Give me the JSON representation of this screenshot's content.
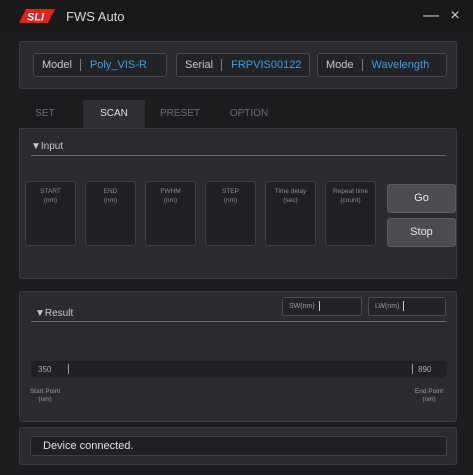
{
  "window": {
    "title": "FWS Auto",
    "logo_text": "SLI",
    "minimize_glyph": "—",
    "close_glyph": "×"
  },
  "device": {
    "model_label": "Model",
    "model_value": "Poly_VIS-R",
    "serial_label": "Serial",
    "serial_value": "FRPVIS00122",
    "mode_label": "Mode",
    "mode_value": "Wavelength"
  },
  "tabs": [
    {
      "label": "SET",
      "active": false
    },
    {
      "label": "SCAN",
      "active": true
    },
    {
      "label": "PRESET",
      "active": false
    },
    {
      "label": "OPTION",
      "active": false
    }
  ],
  "input": {
    "title": "▼Input",
    "params": [
      {
        "name": "START",
        "unit": "(nm)"
      },
      {
        "name": "END",
        "unit": "(nm)"
      },
      {
        "name": "FWHM",
        "unit": "(nm)"
      },
      {
        "name": "STEP",
        "unit": "(nm)"
      },
      {
        "name": "Time delay",
        "unit": "(sec)"
      },
      {
        "name": "Repeat time",
        "unit": "(count)"
      }
    ],
    "go_label": "Go",
    "stop_label": "Stop"
  },
  "result": {
    "title": "▼Result",
    "sw_label": "SW(nm)",
    "lw_label": "LW(nm)",
    "start_value": "350",
    "end_value": "890",
    "start_point_label": "Start Point",
    "start_point_unit": "(nm)",
    "end_point_label": "End Point",
    "end_point_unit": "(nm)"
  },
  "status": {
    "text": "Device connected."
  },
  "colors": {
    "accent_value": "#3aa0e0",
    "logo_red": "#e2231a"
  }
}
